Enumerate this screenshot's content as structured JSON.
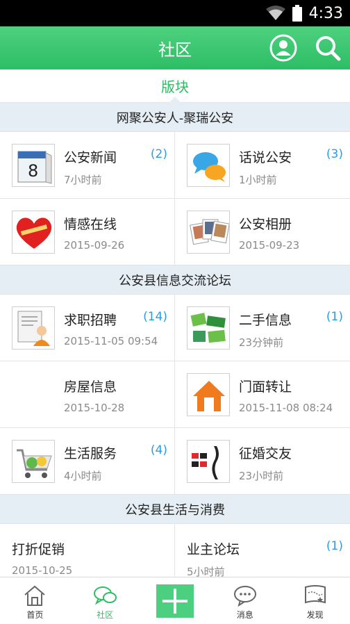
{
  "status_bar": {
    "time": "4:33"
  },
  "header": {
    "title": "社区"
  },
  "segment": {
    "label": "版块"
  },
  "sections": [
    {
      "title": "网聚公安人-聚瑞公安",
      "items": [
        {
          "name": "公安新闻",
          "time": "7小时前",
          "count": "(2)",
          "icon": "calendar-icon"
        },
        {
          "name": "话说公安",
          "time": "1小时前",
          "count": "(3)",
          "icon": "chat-bubbles-icon"
        },
        {
          "name": "情感在线",
          "time": "2015-09-26",
          "count": "",
          "icon": "heart-icon"
        },
        {
          "name": "公安相册",
          "time": "2015-09-23",
          "count": "",
          "icon": "photo-album-icon"
        }
      ]
    },
    {
      "title": "公安县信息交流论坛",
      "items": [
        {
          "name": "求职招聘",
          "time": "2015-11-05 09:54",
          "count": "(14)",
          "icon": "job-resume-icon"
        },
        {
          "name": "二手信息",
          "time": "23分钟前",
          "count": "(1)",
          "icon": "secondhand-icon"
        },
        {
          "name": "房屋信息",
          "time": "2015-10-28",
          "count": "",
          "icon": ""
        },
        {
          "name": "门面转让",
          "time": "2015-11-08 08:24",
          "count": "",
          "icon": "house-icon"
        },
        {
          "name": "生活服务",
          "time": "4小时前",
          "count": "(4)",
          "icon": "shopping-cart-icon"
        },
        {
          "name": "征婚交友",
          "time": "23小时前",
          "count": "",
          "icon": "dating-icon"
        }
      ]
    },
    {
      "title": "公安县生活与消费",
      "items": [
        {
          "name": "打折促销",
          "time": "2015-10-25",
          "count": "",
          "icon": ""
        },
        {
          "name": "业主论坛",
          "time": "5小时前",
          "count": "(1)",
          "icon": ""
        }
      ]
    }
  ],
  "tabs": [
    {
      "label": "首页",
      "icon": "home-icon"
    },
    {
      "label": "社区",
      "icon": "community-chat-icon",
      "active": true
    },
    {
      "label": "",
      "icon": "plus-icon"
    },
    {
      "label": "消息",
      "icon": "message-icon"
    },
    {
      "label": "发现",
      "icon": "discover-flag-icon"
    }
  ],
  "colors": {
    "primary_green": "#2dbd65",
    "count_blue": "#2a9de0",
    "section_bg": "#e4eef4"
  }
}
